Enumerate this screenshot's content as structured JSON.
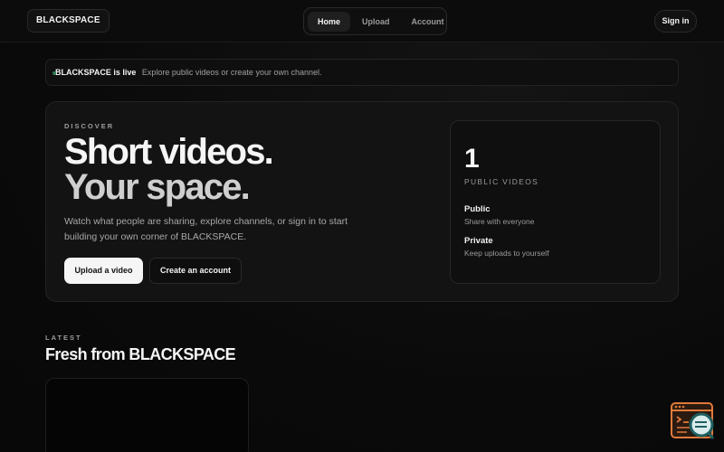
{
  "header": {
    "brand": "BLACKSPACE",
    "nav": [
      {
        "label": "Home",
        "active": true
      },
      {
        "label": "Upload",
        "active": false
      },
      {
        "label": "Account",
        "active": false
      }
    ],
    "signin_label": "Sign in"
  },
  "banner": {
    "title": "BLACKSPACE is live",
    "message": "Explore public videos or create your own channel."
  },
  "hero": {
    "eyebrow": "DISCOVER",
    "headline_line1": "Short videos.",
    "headline_line2": "Your space.",
    "description": "Watch what people are sharing, explore channels, or sign in to start building your own corner of BLACKSPACE.",
    "primary_button": "Upload a video",
    "secondary_button": "Create an account",
    "stats": {
      "count": "1",
      "count_label": "PUBLIC VIDEOS",
      "items": [
        {
          "title": "Public",
          "subtitle": "Share with everyone"
        },
        {
          "title": "Private",
          "subtitle": "Keep uploads to yourself"
        }
      ]
    }
  },
  "latest": {
    "eyebrow": "LATEST",
    "title": "Fresh from BLACKSPACE"
  },
  "colors": {
    "background": "#0a0a0a",
    "accent_light": "#f5f5f5",
    "live_dot": "#2f7a55",
    "helper_widget": "#e07a3a"
  },
  "icons": {
    "helper": "assistant-chat-icon"
  }
}
